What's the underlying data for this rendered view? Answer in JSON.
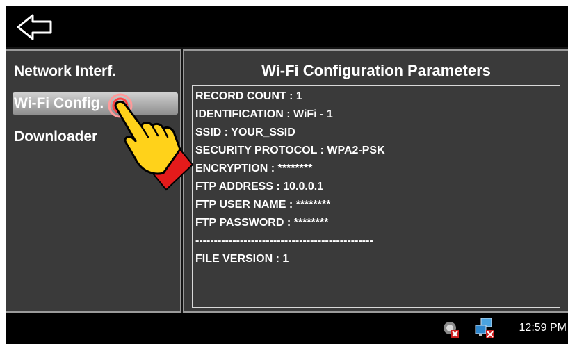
{
  "nav": {
    "items": [
      {
        "label": "Network Interf.",
        "selected": false
      },
      {
        "label": "Wi-Fi Config.",
        "selected": true
      },
      {
        "label": "Downloader",
        "selected": false
      }
    ]
  },
  "main": {
    "title": "Wi-Fi Configuration Parameters",
    "lines": [
      "RECORD COUNT : 1",
      "IDENTIFICATION : WiFi - 1",
      "SSID : YOUR_SSID",
      "SECURITY PROTOCOL : WPA2-PSK",
      "ENCRYPTION : ********",
      "FTP ADDRESS : 10.0.0.1",
      "FTP USER NAME : ********",
      "FTP PASSWORD : ********",
      "------------------------------------------------",
      "FILE VERSION : 1"
    ]
  },
  "taskbar": {
    "clock": "12:59 PM",
    "icons": [
      "sync-status-icon",
      "network-status-icon"
    ]
  },
  "icons": {
    "back": "back-arrow-icon",
    "overlay": "pointing-hand-icon"
  },
  "colors": {
    "background": "#141414",
    "panel": "#3a3a3a",
    "selected_item": "#b5b5b5",
    "error_badge": "#cc1f1f"
  }
}
